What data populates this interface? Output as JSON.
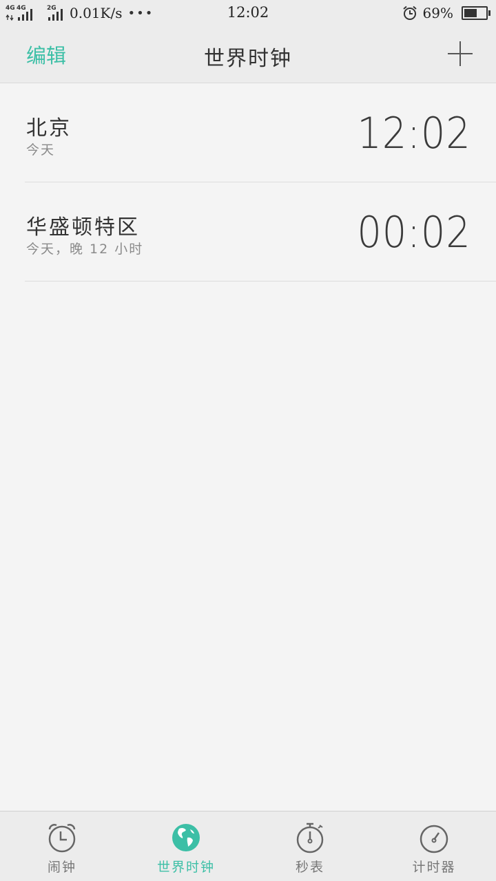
{
  "status_bar": {
    "net_type_1": "4G",
    "net_type_2": "4G",
    "net_type_3": "2G",
    "net_speed": "0.01K/s",
    "overflow": "•••",
    "time": "12:02",
    "battery_percent": "69%",
    "battery_level": 0.69
  },
  "header": {
    "edit_label": "编辑",
    "title": "世界时钟",
    "add_icon": "plus-icon"
  },
  "clocks": [
    {
      "city": "北京",
      "sub": "今天",
      "time": "12:02"
    },
    {
      "city": "华盛顿特区",
      "sub": "今天，晚 12 小时",
      "time": "00:02"
    }
  ],
  "nav": {
    "items": [
      {
        "label": "闹钟",
        "icon": "alarm-clock-icon"
      },
      {
        "label": "世界时钟",
        "icon": "globe-icon"
      },
      {
        "label": "秒表",
        "icon": "stopwatch-icon"
      },
      {
        "label": "计时器",
        "icon": "timer-icon"
      }
    ],
    "active_index": 1
  },
  "colors": {
    "accent": "#3cbfa6",
    "background": "#f4f4f4",
    "bar_background": "#ececec"
  }
}
